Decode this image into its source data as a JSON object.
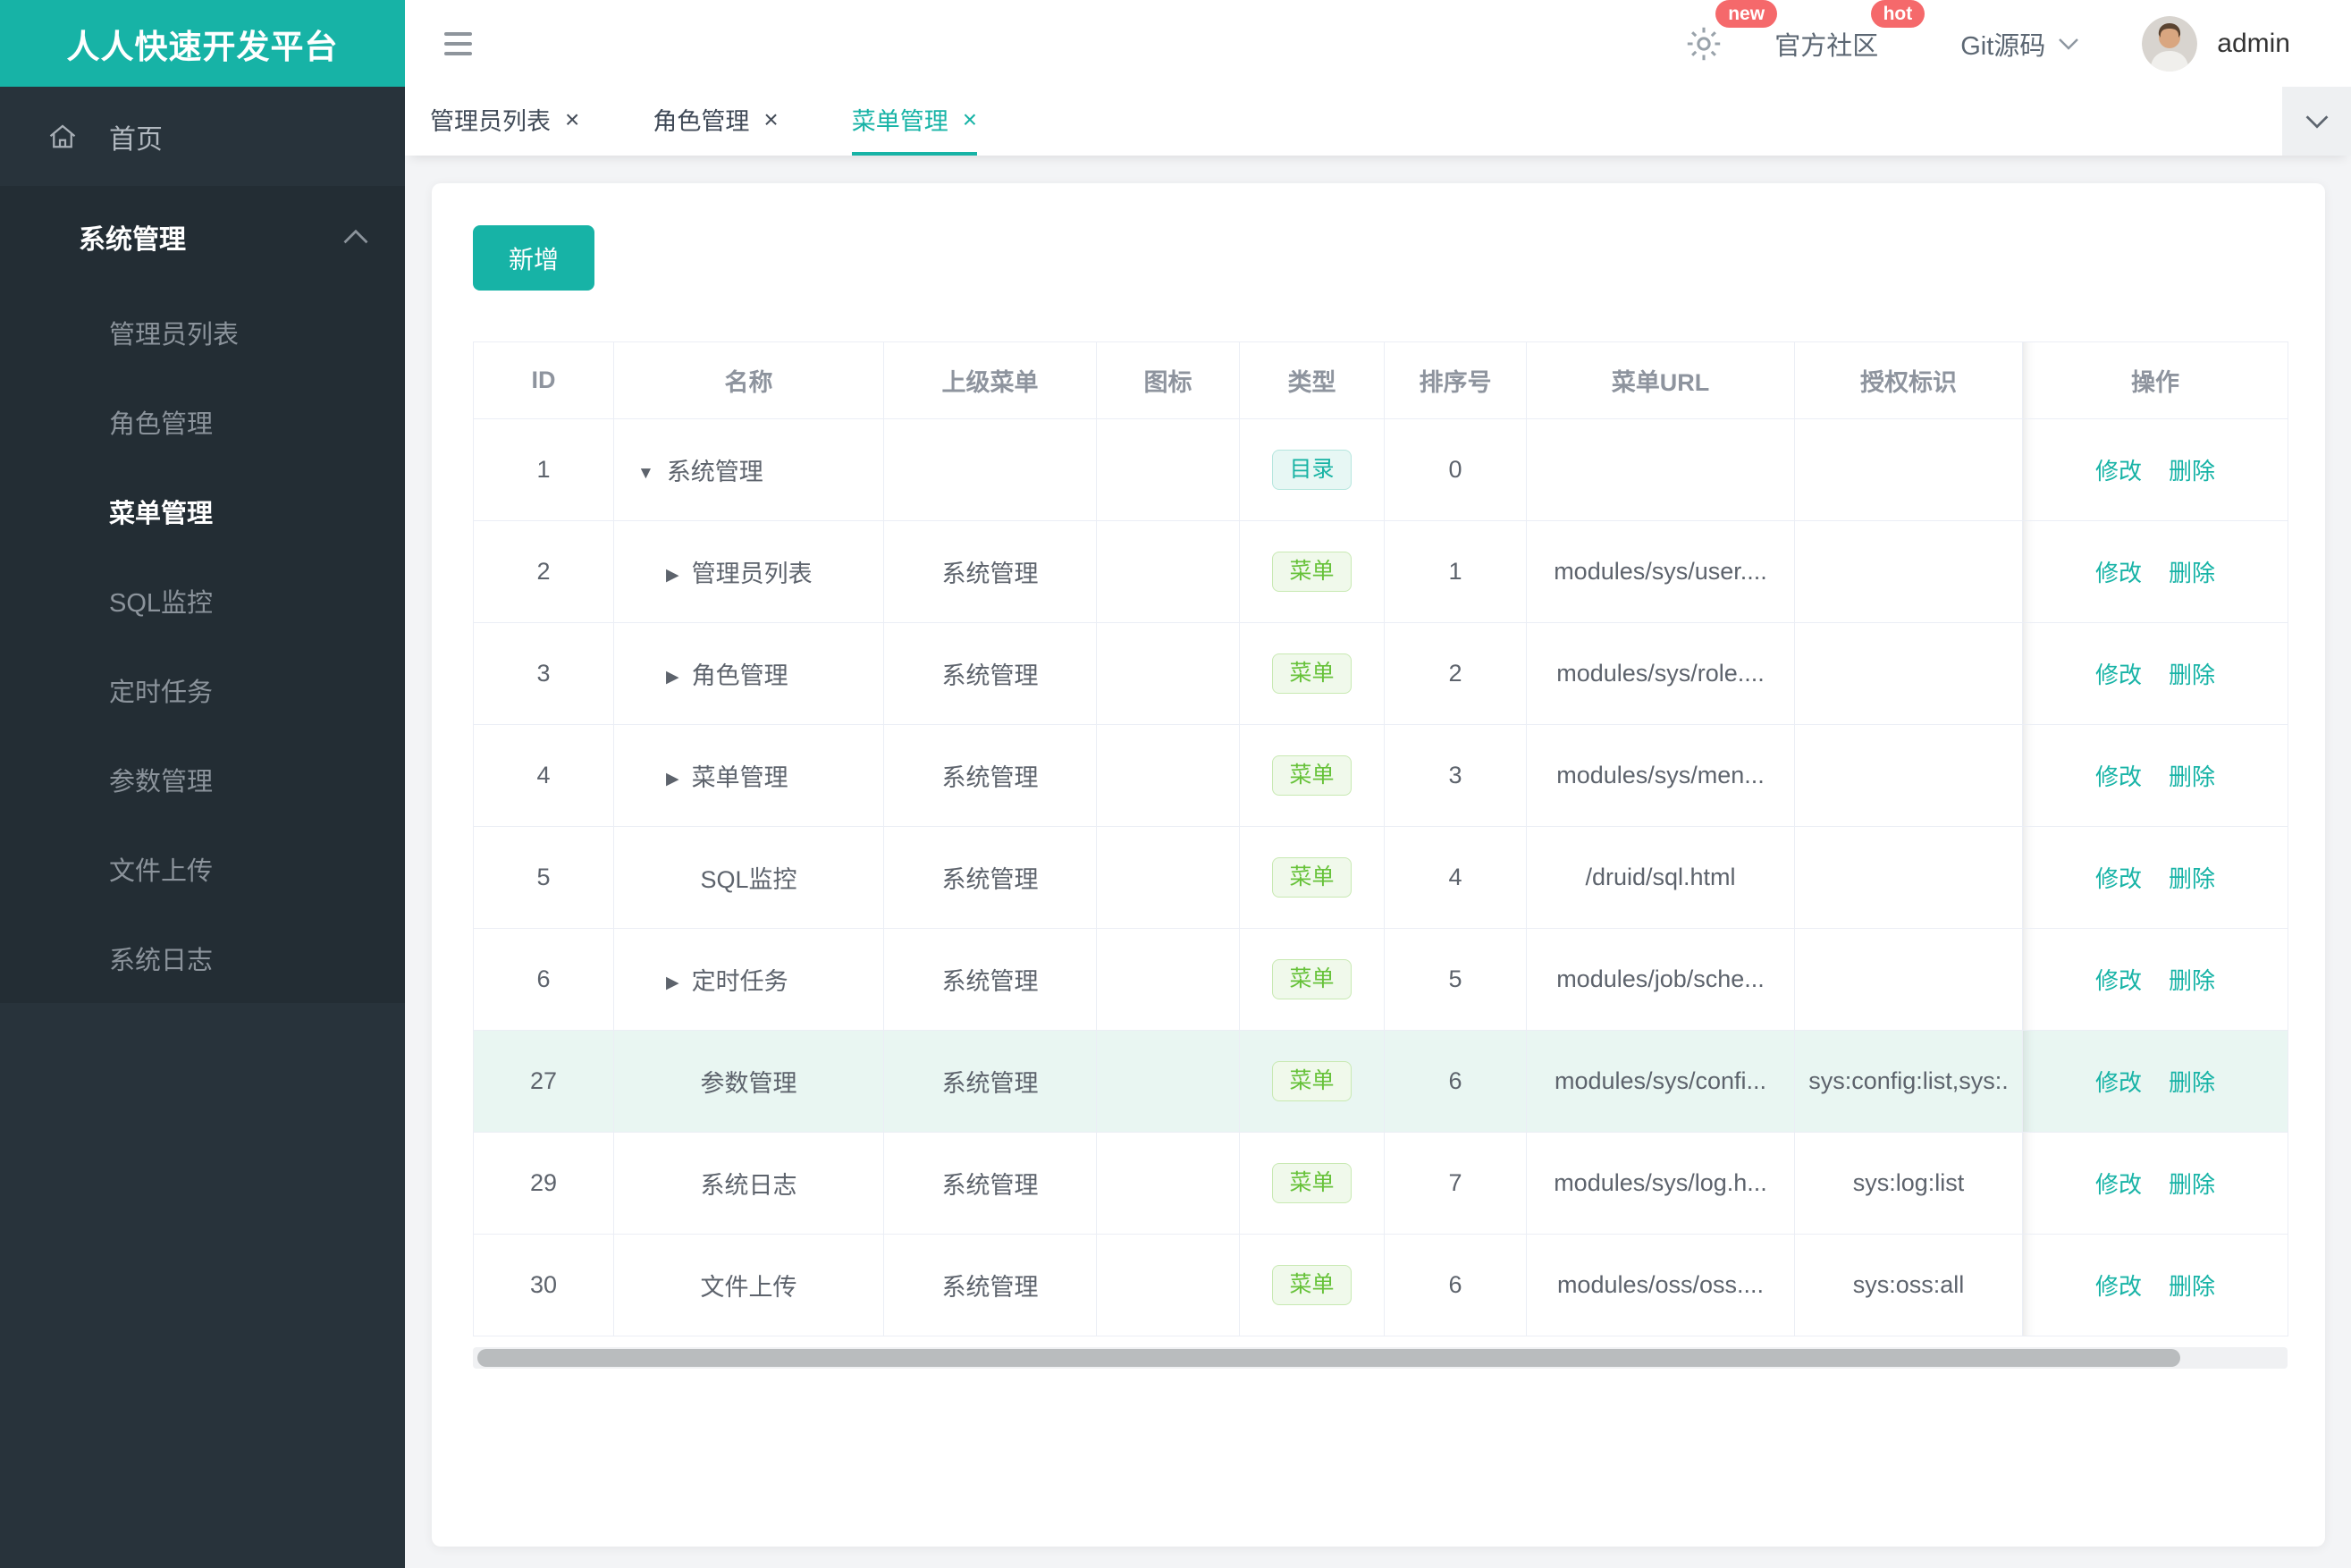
{
  "app": {
    "logo_title": "人人快速开发平台"
  },
  "header": {
    "new_badge": "new",
    "community_label": "官方社区",
    "hot_badge": "hot",
    "git_label": "Git源码",
    "username": "admin"
  },
  "sidebar": {
    "home_label": "首页",
    "section": {
      "label": "系统管理",
      "active": "菜单管理",
      "items": [
        "管理员列表",
        "角色管理",
        "菜单管理",
        "SQL监控",
        "定时任务",
        "参数管理",
        "文件上传",
        "系统日志"
      ]
    }
  },
  "tabs": {
    "close_glyph": "×",
    "items": [
      {
        "label": "管理员列表",
        "active": false
      },
      {
        "label": "角色管理",
        "active": false
      },
      {
        "label": "菜单管理",
        "active": true
      }
    ]
  },
  "toolbar": {
    "add_label": "新增"
  },
  "table": {
    "columns": [
      "ID",
      "名称",
      "上级菜单",
      "图标",
      "类型",
      "排序号",
      "菜单URL",
      "授权标识",
      "操作"
    ],
    "type_badges": {
      "dir": "目录",
      "menu": "菜单"
    },
    "actions": {
      "edit": "修改",
      "delete": "删除"
    },
    "arrow_glyphs": {
      "down": "▼",
      "right": "▶"
    },
    "rows": [
      {
        "id": "1",
        "name": "系统管理",
        "arrow": "down",
        "parent": "",
        "type": "dir",
        "order": "0",
        "url": "",
        "perm": "",
        "highlight": false
      },
      {
        "id": "2",
        "name": "管理员列表",
        "arrow": "right",
        "parent": "系统管理",
        "type": "menu",
        "order": "1",
        "url": "modules/sys/user....",
        "perm": "",
        "highlight": false
      },
      {
        "id": "3",
        "name": "角色管理",
        "arrow": "right",
        "parent": "系统管理",
        "type": "menu",
        "order": "2",
        "url": "modules/sys/role....",
        "perm": "",
        "highlight": false
      },
      {
        "id": "4",
        "name": "菜单管理",
        "arrow": "right",
        "parent": "系统管理",
        "type": "menu",
        "order": "3",
        "url": "modules/sys/men...",
        "perm": "",
        "highlight": false
      },
      {
        "id": "5",
        "name": "SQL监控",
        "arrow": "none",
        "parent": "系统管理",
        "type": "menu",
        "order": "4",
        "url": "/druid/sql.html",
        "perm": "",
        "highlight": false
      },
      {
        "id": "6",
        "name": "定时任务",
        "arrow": "right",
        "parent": "系统管理",
        "type": "menu",
        "order": "5",
        "url": "modules/job/sche...",
        "perm": "",
        "highlight": false
      },
      {
        "id": "27",
        "name": "参数管理",
        "arrow": "none",
        "parent": "系统管理",
        "type": "menu",
        "order": "6",
        "url": "modules/sys/confi...",
        "perm": "sys:config:list,sys:.",
        "highlight": true
      },
      {
        "id": "29",
        "name": "系统日志",
        "arrow": "none",
        "parent": "系统管理",
        "type": "menu",
        "order": "7",
        "url": "modules/sys/log.h...",
        "perm": "sys:log:list",
        "highlight": false
      },
      {
        "id": "30",
        "name": "文件上传",
        "arrow": "none",
        "parent": "系统管理",
        "type": "menu",
        "order": "6",
        "url": "modules/oss/oss....",
        "perm": "sys:oss:all",
        "highlight": false
      }
    ]
  },
  "colors": {
    "accent_teal": "#17b3a6",
    "badge_red": "#f5696b",
    "sidebar_bg": "#28333b",
    "sidebar_section_bg": "#232d34",
    "tag_dir_text": "#18b3a4",
    "tag_menu_text": "#67c23a",
    "row_highlight": "#e9f6f2"
  }
}
